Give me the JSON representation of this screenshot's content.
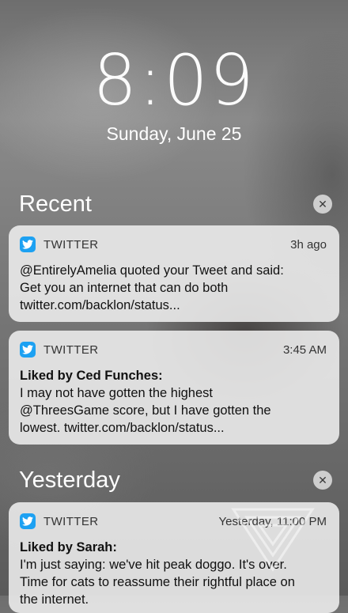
{
  "lockscreen": {
    "time": "8:09",
    "date": "Sunday, June 25"
  },
  "sections": {
    "recent": {
      "title": "Recent",
      "clear_icon": "close-icon"
    },
    "yesterday": {
      "title": "Yesterday",
      "clear_icon": "close-icon"
    }
  },
  "notifications": [
    {
      "app": "TWITTER",
      "app_icon": "twitter-bird-icon",
      "time": "3h ago",
      "title": "",
      "lines": [
        "@EntirelyAmelia quoted your Tweet and said:",
        "Get you an internet that can do both",
        "twitter.com/backlon/status..."
      ]
    },
    {
      "app": "TWITTER",
      "app_icon": "twitter-bird-icon",
      "time": "3:45 AM",
      "title": "Liked by Ced Funches:",
      "lines": [
        "I may not have gotten the highest",
        "@ThreesGame score, but I have gotten the",
        "lowest. twitter.com/backlon/status..."
      ]
    },
    {
      "app": "TWITTER",
      "app_icon": "twitter-bird-icon",
      "time": "Yesterday, 11:00 PM",
      "title": "Liked by Sarah:",
      "lines": [
        "I'm just saying: we've hit peak doggo. It's over.",
        "Time for cats to reassume their rightful place on",
        "the internet."
      ]
    }
  ],
  "colors": {
    "twitter_blue": "#1da1f2",
    "card_background": "#eeeeee",
    "text": "#111111"
  }
}
